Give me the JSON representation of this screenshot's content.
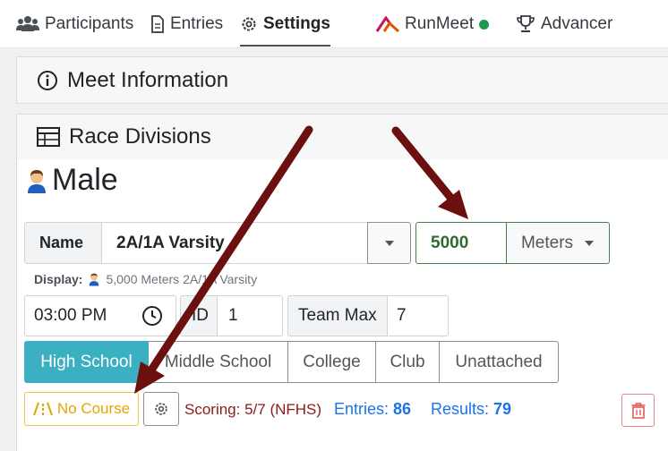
{
  "nav": {
    "participants": "Participants",
    "entries": "Entries",
    "settings": "Settings",
    "runmeet": "RunMeet",
    "advancer": "Advancer"
  },
  "sections": {
    "meet_information": "Meet Information",
    "race_divisions": "Race Divisions"
  },
  "division": {
    "gender": "Male",
    "name_label": "Name",
    "name_value": "2A/1A Varsity",
    "distance_value": "5000",
    "unit_value": "Meters",
    "display_label": "Display:",
    "display_value": "5,000 Meters 2A/1A Varsity",
    "time_value": "03:00 PM",
    "id_label": "ID",
    "id_value": "1",
    "team_max_label": "Team Max",
    "team_max_value": "7"
  },
  "levels": [
    "High School",
    "Middle School",
    "College",
    "Club",
    "Unattached"
  ],
  "footer": {
    "no_course": "No Course",
    "scoring": "Scoring: 5/7 (NFHS)",
    "entries_label": "Entries:",
    "entries_value": "86",
    "results_label": "Results:",
    "results_value": "79"
  },
  "colors": {
    "active_level": "#3ab0c2",
    "arrow": "#6b0f0f",
    "distance_text": "#2e6b2e",
    "runmeet_status": "#1a9a4a"
  }
}
